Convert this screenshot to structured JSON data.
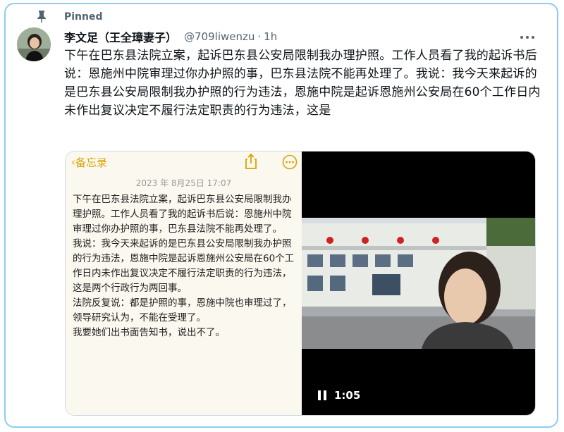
{
  "pinned": {
    "label": "Pinned",
    "icon": "pin-icon"
  },
  "author": {
    "display_name": "李文足（王全璋妻子）",
    "handle": "@709liwenzu",
    "separator": "·",
    "time": "1h"
  },
  "tweet": {
    "text": "下午在巴东县法院立案，起诉巴东县公安局限制我办理护照。工作人员看了我的起诉书后说：恩施州中院审理过你办护照的事，巴东县法院不能再处理了。我说：我今天来起诉的是巴东县公安局限制我办护照的行为违法，恩施中院是起诉恩施州公安局在60个工作日内未作出复议决定不履行法定职责的行为违法，这是"
  },
  "note": {
    "back_glyph": "‹",
    "app_name": "备忘录",
    "date": "2023 年 8月25日  17:07",
    "paragraphs": [
      "下午在巴东县法院立案，起诉巴东县公安局限制我办理护照。工作人员看了我的起诉书后说：恩施州中院审理过你办护照的事，巴东县法院不能再处理了。",
      "我说：我今天来起诉的是巴东县公安局限制我办护照的行为违法，恩施中院是起诉恩施州公安局在60个工作日内未作出复议决定不履行法定职责的行为违法，这是两个行政行为两回事。",
      "法院反复说：都是护照的事，恩施中院也审理过了，领导研究认为，不能在受理了。",
      "我要她们出书面告知书，说出不了。"
    ]
  },
  "video": {
    "time": "1:05"
  },
  "colors": {
    "accent": "#1d9bf0",
    "frame_border": "#8ecdf0",
    "note_yellow": "#d9a300"
  }
}
